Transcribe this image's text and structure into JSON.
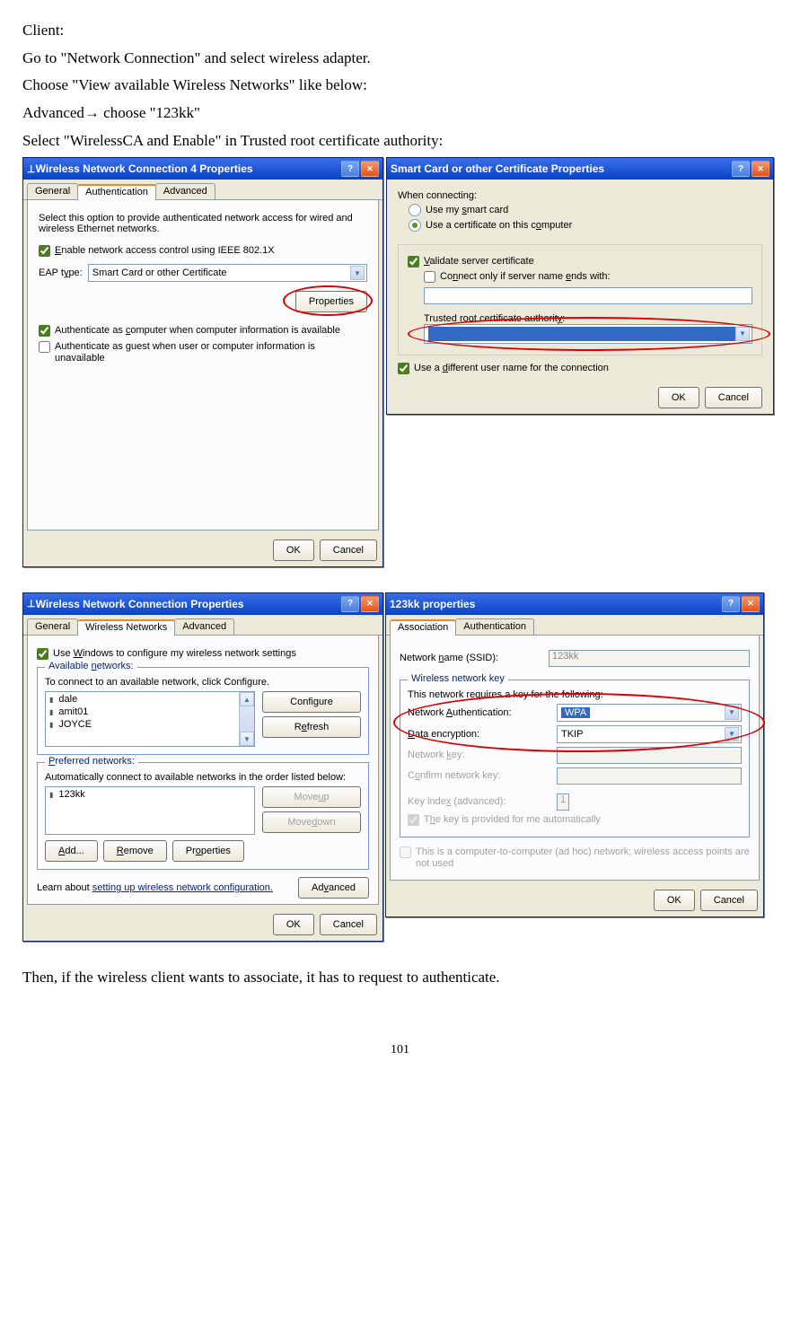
{
  "doc": {
    "l1": "Client:",
    "l2": "Go to \"Network Connection\" and select wireless adapter.",
    "l3": "Choose \"View available Wireless Networks\" like below:",
    "l4": "Advanced→ choose \"123kk\"",
    "l5": "Select \"WirelessCA and Enable\" in Trusted root certificate authority:",
    "l6": "Then, if the wireless client wants to associate, it has to request to authenticate.",
    "page": "101"
  },
  "dlg1": {
    "title": "Wireless Network Connection 4 Properties",
    "tabs": {
      "a": "General",
      "b": "Authentication",
      "c": "Advanced"
    },
    "desc": "Select this option to provide authenticated network access for wired and wireless Ethernet networks.",
    "chk1": "Enable network access control using IEEE 802.1X",
    "eap_label": "EAP type:",
    "eap_value": "Smart Card or other Certificate",
    "props": "Properties",
    "chk2": "Authenticate as computer when computer information is available",
    "chk3": "Authenticate as guest when user or computer information is unavailable",
    "ok": "OK",
    "cancel": "Cancel"
  },
  "dlg2": {
    "title": "Smart Card or other Certificate Properties",
    "when": "When connecting:",
    "r1": "Use my smart card",
    "r2": "Use a certificate on this computer",
    "chk_v": "Validate server certificate",
    "chk_conn": "Connect only if server name ends with:",
    "trca": "Trusted root certificate authority:",
    "chk_diff": "Use a different user name for the connection",
    "ok": "OK",
    "cancel": "Cancel"
  },
  "dlg3": {
    "title": "Wireless Network Connection Properties",
    "tabs": {
      "a": "General",
      "b": "Wireless Networks",
      "c": "Advanced"
    },
    "chk_win": "Use Windows to configure my wireless network settings",
    "grp_avail": "Available networks:",
    "avail_desc": "To connect to an available network, click Configure.",
    "nets": [
      "dale",
      "amit01",
      "JOYCE"
    ],
    "btn_conf": "Configure",
    "btn_ref": "Refresh",
    "grp_pref": "Preferred networks:",
    "pref_desc": "Automatically connect to available networks in the order listed below:",
    "pref_nets": [
      "123kk"
    ],
    "btn_up": "Move up",
    "btn_down": "Move down",
    "btn_add": "Add...",
    "btn_rem": "Remove",
    "btn_prop": "Properties",
    "learn": "Learn about ",
    "learn_link": "setting up wireless network configuration.",
    "btn_adv": "Advanced",
    "ok": "OK",
    "cancel": "Cancel"
  },
  "dlg4": {
    "title": "123kk properties",
    "tabs": {
      "a": "Association",
      "b": "Authentication"
    },
    "ssid_lbl": "Network name (SSID):",
    "ssid_val": "123kk",
    "grp_key": "Wireless network key",
    "key_desc": "This network requires a key for the following:",
    "na_lbl": "Network Authentication:",
    "na_val": "WPA",
    "de_lbl": "Data encryption:",
    "de_val": "TKIP",
    "nk_lbl": "Network key:",
    "cnk_lbl": "Confirm network key:",
    "ki_lbl": "Key index (advanced):",
    "ki_val": "1",
    "chk_auto": "The key is provided for me automatically",
    "chk_adhoc": "This is a computer-to-computer (ad hoc) network; wireless access points are not used",
    "ok": "OK",
    "cancel": "Cancel"
  }
}
